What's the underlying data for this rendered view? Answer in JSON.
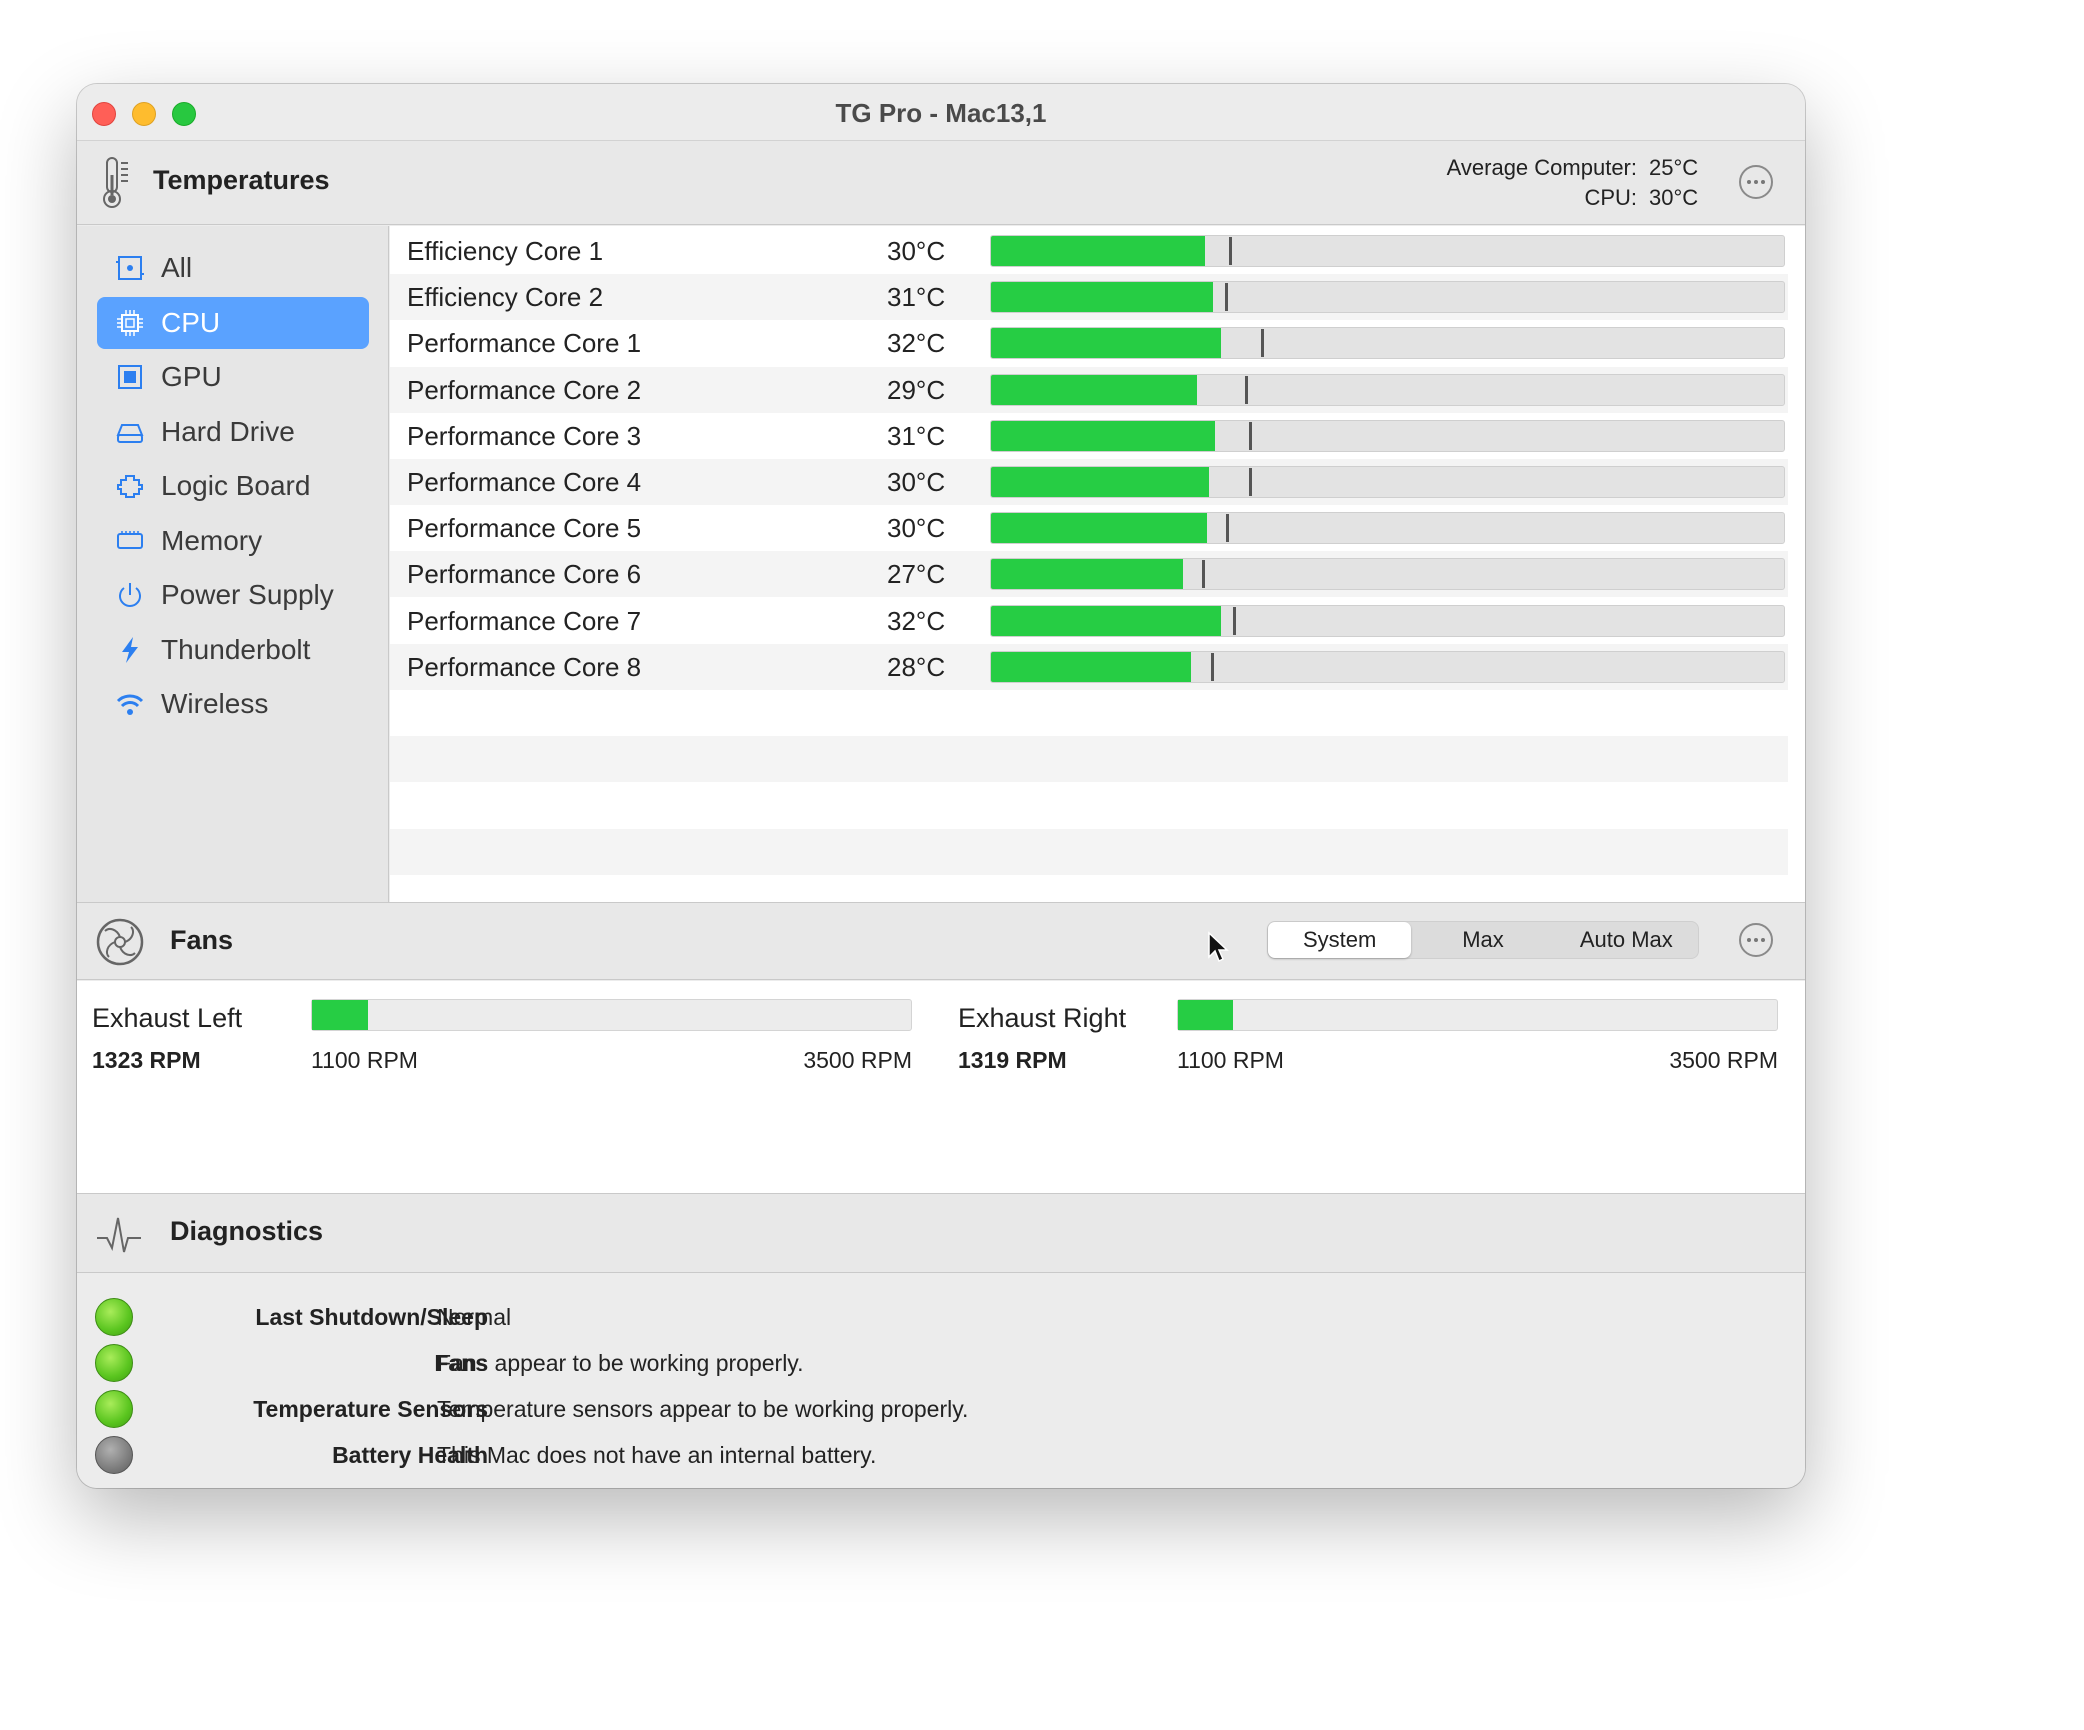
{
  "window": {
    "title": "TG Pro - Mac13,1"
  },
  "temperatures": {
    "title": "Temperatures",
    "average_label": "Average Computer:",
    "average_value": "25°C",
    "cpu_label": "CPU:",
    "cpu_value": "30°C",
    "sidebar": [
      {
        "label": "All",
        "icon": "all-icon"
      },
      {
        "label": "CPU",
        "icon": "cpu-icon",
        "selected": true
      },
      {
        "label": "GPU",
        "icon": "gpu-icon"
      },
      {
        "label": "Hard Drive",
        "icon": "hard-drive-icon"
      },
      {
        "label": "Logic Board",
        "icon": "logic-board-icon"
      },
      {
        "label": "Memory",
        "icon": "memory-icon"
      },
      {
        "label": "Power Supply",
        "icon": "power-icon"
      },
      {
        "label": "Thunderbolt",
        "icon": "thunderbolt-icon"
      },
      {
        "label": "Wireless",
        "icon": "wifi-icon"
      }
    ],
    "sensors": [
      {
        "name": "Efficiency Core 1",
        "value": "30°C",
        "level": 0.27,
        "max_marker": 0.3
      },
      {
        "name": "Efficiency Core 2",
        "value": "31°C",
        "level": 0.28,
        "max_marker": 0.295
      },
      {
        "name": "Performance Core 1",
        "value": "32°C",
        "level": 0.29,
        "max_marker": 0.34
      },
      {
        "name": "Performance Core 2",
        "value": "29°C",
        "level": 0.26,
        "max_marker": 0.32
      },
      {
        "name": "Performance Core 3",
        "value": "31°C",
        "level": 0.283,
        "max_marker": 0.325
      },
      {
        "name": "Performance Core 4",
        "value": "30°C",
        "level": 0.275,
        "max_marker": 0.325
      },
      {
        "name": "Performance Core 5",
        "value": "30°C",
        "level": 0.272,
        "max_marker": 0.296
      },
      {
        "name": "Performance Core 6",
        "value": "27°C",
        "level": 0.242,
        "max_marker": 0.266
      },
      {
        "name": "Performance Core 7",
        "value": "32°C",
        "level": 0.29,
        "max_marker": 0.305
      },
      {
        "name": "Performance Core 8",
        "value": "28°C",
        "level": 0.252,
        "max_marker": 0.278
      }
    ]
  },
  "fans": {
    "title": "Fans",
    "modes": [
      "System",
      "Max",
      "Auto Max"
    ],
    "selected_mode": "System",
    "items": [
      {
        "name": "Exhaust Left",
        "rpm": "1323 RPM",
        "min": "1100 RPM",
        "max": "3500 RPM",
        "level": 0.093
      },
      {
        "name": "Exhaust Right",
        "rpm": "1319 RPM",
        "min": "1100 RPM",
        "max": "3500 RPM",
        "level": 0.091
      }
    ]
  },
  "diagnostics": {
    "title": "Diagnostics",
    "items": [
      {
        "label": "Last Shutdown/Sleep",
        "text": "Normal",
        "status": "ok"
      },
      {
        "label": "Fans",
        "text": "Fans appear to be working properly.",
        "status": "ok"
      },
      {
        "label": "Temperature Sensors",
        "text": "Temperature sensors appear to be working properly.",
        "status": "ok"
      },
      {
        "label": "Battery Health",
        "text": "This Mac does not have an internal battery.",
        "status": "na"
      }
    ]
  },
  "colors": {
    "bar_fill": "#26cd44",
    "selection": "#5aa2ff",
    "status_ok": "#5ac51f",
    "status_na": "#7d7d7d"
  }
}
